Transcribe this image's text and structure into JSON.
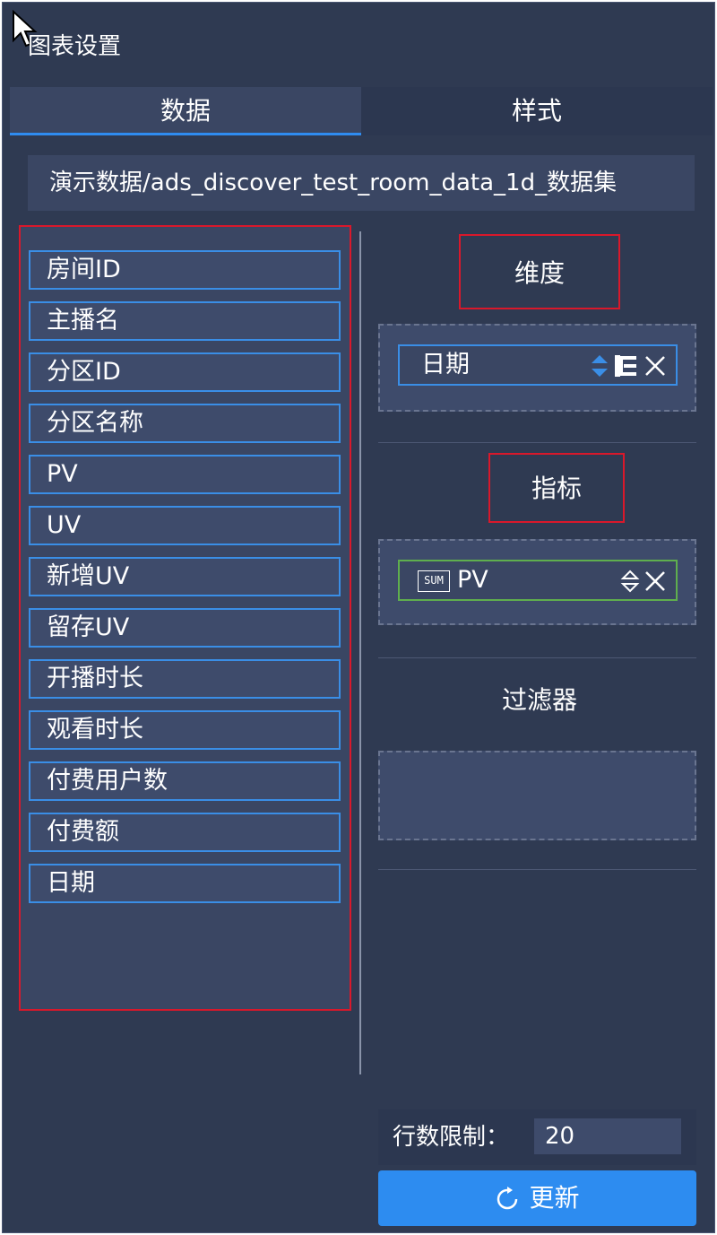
{
  "header": {
    "title": "图表设置"
  },
  "tabs": [
    {
      "label": "数据",
      "active": true
    },
    {
      "label": "样式",
      "active": false
    }
  ],
  "dataset": {
    "path": "演示数据/ads_discover_test_room_data_1d_数据集"
  },
  "fields": [
    {
      "label": "房间ID"
    },
    {
      "label": "主播名"
    },
    {
      "label": "分区ID"
    },
    {
      "label": "分区名称"
    },
    {
      "label": "PV"
    },
    {
      "label": "UV"
    },
    {
      "label": "新增UV"
    },
    {
      "label": "留存UV"
    },
    {
      "label": "开播时长"
    },
    {
      "label": "观看时长"
    },
    {
      "label": "付费用户数"
    },
    {
      "label": "付费额"
    },
    {
      "label": "日期"
    }
  ],
  "sections": {
    "dimension": {
      "label": "维度",
      "items": [
        {
          "label": "日期"
        }
      ]
    },
    "metric": {
      "label": "指标",
      "items": [
        {
          "label": "PV",
          "agg": "SUM"
        }
      ]
    },
    "filter": {
      "label": "过滤器",
      "items": []
    }
  },
  "footer": {
    "row_limit_label": "行数限制：",
    "row_limit_value": "20",
    "update_label": "更新"
  },
  "colors": {
    "panel_bg": "#2f3a52",
    "accent": "#2d8cf0",
    "field_border": "#3a8ee6",
    "metric_border": "#5fae4e",
    "highlight_red": "#d9182b"
  },
  "icons": [
    "cursor-arrow-icon",
    "sort-icon",
    "tree-icon",
    "close-icon",
    "refresh-icon"
  ]
}
